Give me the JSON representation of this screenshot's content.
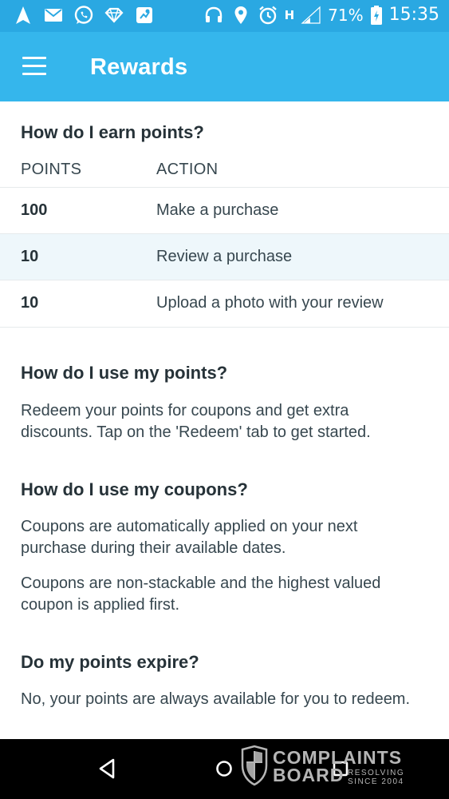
{
  "status_bar": {
    "battery_percent": "71%",
    "time": "15:35",
    "signal_label": "H",
    "icons_left": [
      "navigation-icon",
      "mail-icon",
      "whatsapp-icon",
      "diamond-icon",
      "maps-icon"
    ],
    "icons_right": [
      "headphones-icon",
      "location-icon",
      "alarm-icon",
      "signal-icon",
      "battery-icon"
    ]
  },
  "app_bar": {
    "title": "Rewards",
    "menu_icon": "hamburger-menu-icon",
    "color": "#35b6ec"
  },
  "earn": {
    "title": "How do I earn points?",
    "col_points": "POINTS",
    "col_action": "ACTION",
    "rows": [
      {
        "points": "100",
        "action": "Make a purchase"
      },
      {
        "points": "10",
        "action": "Review a purchase"
      },
      {
        "points": "10",
        "action": "Upload a photo with your review"
      }
    ]
  },
  "use_points": {
    "title": "How do I use my points?",
    "body": "Redeem your points for coupons and get extra discounts. Tap on the 'Redeem' tab to get started."
  },
  "use_coupons": {
    "title": "How do I use my coupons?",
    "body1": "Coupons are automatically applied on your next purchase during their available dates.",
    "body2": "Coupons are non-stackable and the highest valued coupon is applied first."
  },
  "expire": {
    "title": "Do my points expire?",
    "body": "No, your points are always available for you to redeem."
  },
  "nav": {
    "back_icon": "back-triangle-icon",
    "home_icon": "home-circle-icon",
    "recents_icon": "recents-square-icon"
  },
  "watermark": {
    "line1": "COMPLAINTS",
    "line2": "BOARD",
    "tag1": "RESOLVING",
    "tag2": "SINCE 2004"
  }
}
